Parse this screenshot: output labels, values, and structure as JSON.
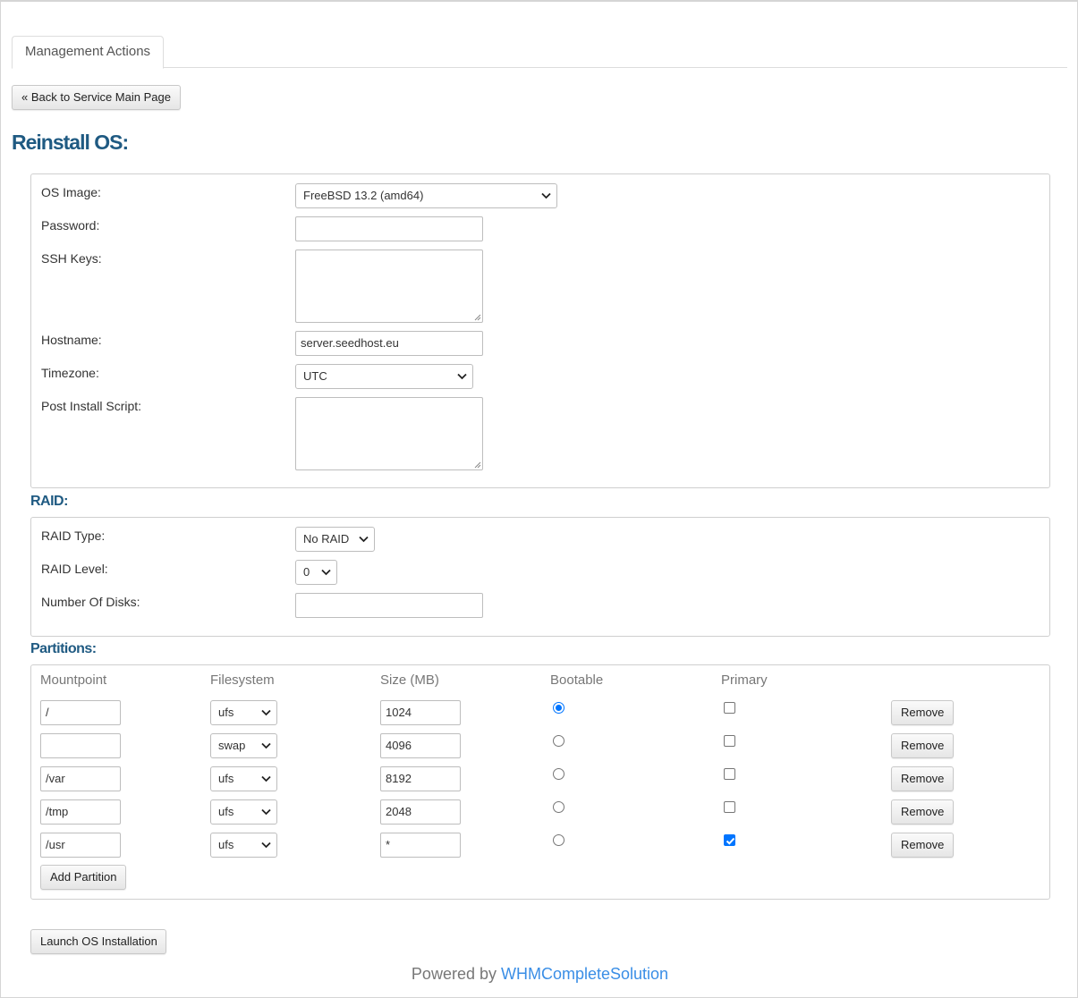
{
  "tabs": [
    {
      "label": "Management Actions"
    }
  ],
  "back_button": "« Back to Service Main Page",
  "page_title": "Reinstall OS:",
  "os_form": {
    "os_image_label": "OS Image:",
    "os_image_value": "FreeBSD 13.2 (amd64)",
    "password_label": "Password:",
    "password_value": "",
    "ssh_keys_label": "SSH Keys:",
    "hostname_label": "Hostname:",
    "hostname_value": "server.seedhost.eu",
    "timezone_label": "Timezone:",
    "timezone_value": "UTC",
    "post_install_label": "Post Install Script:"
  },
  "raid": {
    "heading": "RAID:",
    "type_label": "RAID Type:",
    "type_value": "No RAID",
    "level_label": "RAID Level:",
    "level_value": "0",
    "disks_label": "Number Of Disks:",
    "disks_value": ""
  },
  "partitions": {
    "heading": "Partitions:",
    "columns": [
      "Mountpoint",
      "Filesystem",
      "Size (MB)",
      "Bootable",
      "Primary"
    ],
    "rows": [
      {
        "mountpoint": "/",
        "filesystem": "ufs",
        "size": "1024",
        "bootable": true,
        "primary": false,
        "remove": "Remove"
      },
      {
        "mountpoint": "",
        "filesystem": "swap",
        "size": "4096",
        "bootable": false,
        "primary": false,
        "remove": "Remove"
      },
      {
        "mountpoint": "/var",
        "filesystem": "ufs",
        "size": "8192",
        "bootable": false,
        "primary": false,
        "remove": "Remove"
      },
      {
        "mountpoint": "/tmp",
        "filesystem": "ufs",
        "size": "2048",
        "bootable": false,
        "primary": false,
        "remove": "Remove"
      },
      {
        "mountpoint": "/usr",
        "filesystem": "ufs",
        "size": "*",
        "bootable": false,
        "primary": true,
        "remove": "Remove"
      }
    ],
    "add_button": "Add Partition"
  },
  "launch_button": "Launch OS Installation",
  "footer": {
    "prefix": "Powered by ",
    "link": "WHMCompleteSolution"
  },
  "colors": {
    "heading": "#1f5a82",
    "link": "#3a8ee6",
    "accent": "#0075ff"
  }
}
